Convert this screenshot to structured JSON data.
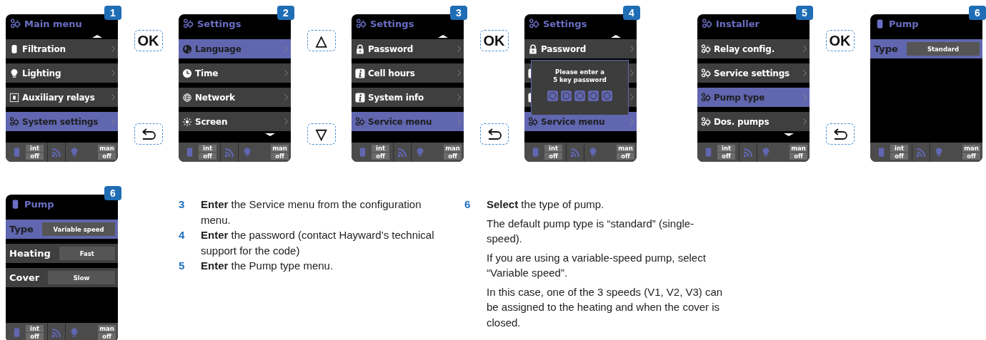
{
  "top_row": [
    {
      "kind": "screen",
      "badge": "1",
      "header": {
        "kind": "gears",
        "title": "Main menu"
      },
      "scroll_up": true,
      "scroll_down": false,
      "rows": [
        {
          "kind": "pump",
          "label": "Filtration",
          "selected": false
        },
        {
          "kind": "bulb",
          "label": "Lighting",
          "selected": false
        },
        {
          "kind": "relay",
          "label": "Auxiliary relays",
          "selected": false
        },
        {
          "kind": "gears",
          "label": "System settings",
          "selected": true
        }
      ],
      "status": {
        "filtration_mode": "int",
        "filtration_state": "off",
        "lighting_mode": "man",
        "lighting_state": "off"
      }
    },
    {
      "kind": "keys",
      "keys": [
        {
          "kind": "text",
          "label": "OK"
        },
        {
          "kind": "back"
        }
      ]
    },
    {
      "kind": "screen",
      "badge": "2",
      "header": {
        "kind": "gears",
        "title": "Settings"
      },
      "scroll_up": false,
      "scroll_down": true,
      "rows": [
        {
          "kind": "language",
          "label": "Language",
          "selected": true
        },
        {
          "kind": "clock",
          "label": "Time",
          "selected": false
        },
        {
          "kind": "network",
          "label": "Network",
          "selected": false
        },
        {
          "kind": "sun",
          "label": "Screen",
          "selected": false
        }
      ],
      "status": {
        "filtration_mode": "int",
        "filtration_state": "off",
        "lighting_mode": "man",
        "lighting_state": "off"
      }
    },
    {
      "kind": "keys",
      "keys": [
        {
          "kind": "text",
          "label": "△"
        },
        {
          "kind": "text",
          "label": "▽"
        }
      ]
    },
    {
      "kind": "screen",
      "badge": "3",
      "header": {
        "kind": "gears",
        "title": "Settings"
      },
      "scroll_up": true,
      "scroll_down": false,
      "rows": [
        {
          "kind": "lock",
          "label": "Password",
          "selected": false
        },
        {
          "kind": "info",
          "label": "Cell hours",
          "selected": false
        },
        {
          "kind": "info",
          "label": "System info",
          "selected": false
        },
        {
          "kind": "gears",
          "label": "Service menu",
          "selected": true
        }
      ],
      "status": {
        "filtration_mode": "int",
        "filtration_state": "off",
        "lighting_mode": "man",
        "lighting_state": "off"
      }
    },
    {
      "kind": "keys",
      "keys": [
        {
          "kind": "text",
          "label": "OK"
        },
        {
          "kind": "back"
        }
      ]
    },
    {
      "kind": "screen",
      "badge": "4",
      "header": {
        "kind": "gears",
        "title": "Settings"
      },
      "scroll_up": true,
      "scroll_down": false,
      "rows": [
        {
          "kind": "lock",
          "label": "Password",
          "selected": false
        },
        {
          "kind": "info",
          "selected": false
        },
        {
          "kind": "info",
          "selected": false
        },
        {
          "kind": "gears",
          "label": "Service menu",
          "selected": true
        }
      ],
      "dialog": {
        "lines": [
          "Please enter a",
          "5 key password"
        ],
        "slots": [
          {
            "entered": false
          },
          {
            "entered": false
          },
          {
            "entered": false
          },
          {
            "entered": false
          },
          {
            "entered": false
          }
        ]
      },
      "status": {
        "filtration_mode": "int",
        "filtration_state": "off",
        "lighting_mode": "man",
        "lighting_state": "off"
      }
    },
    {
      "kind": "screen",
      "badge": "5",
      "header": {
        "kind": "gears",
        "title": "Installer"
      },
      "scroll_up": false,
      "scroll_down": true,
      "rows": [
        {
          "kind": "gears",
          "label": "Relay config.",
          "selected": false
        },
        {
          "kind": "gears",
          "label": "Service settings",
          "selected": false
        },
        {
          "kind": "gears",
          "label": "Pump type",
          "selected": true
        },
        {
          "kind": "gears",
          "label": "Dos. pumps",
          "selected": false
        }
      ],
      "status": {
        "filtration_mode": "int",
        "filtration_state": "off",
        "lighting_mode": "man",
        "lighting_state": "off"
      }
    },
    {
      "kind": "keys",
      "keys": [
        {
          "kind": "text",
          "label": "OK"
        },
        {
          "kind": "back"
        }
      ]
    },
    {
      "kind": "screen",
      "badge": "6",
      "header": {
        "kind": "pump",
        "title": "Pump"
      },
      "scroll_up": false,
      "scroll_down": false,
      "rows": [
        {
          "kind": "setting",
          "label": "Type",
          "value": "Standard",
          "selected": true
        }
      ],
      "status": {
        "filtration_mode": "int",
        "filtration_state": "off",
        "lighting_mode": "man",
        "lighting_state": "off"
      }
    }
  ],
  "bottom_screen": {
    "badge": "6",
    "header": {
      "kind": "pump",
      "title": "Pump"
    },
    "scroll_up": false,
    "scroll_down": false,
    "rows": [
      {
        "kind": "setting",
        "label": "Type",
        "value": "Variable speed",
        "selected": true
      },
      {
        "kind": "setting",
        "label": "Heating",
        "value": "Fast",
        "selected": false
      },
      {
        "kind": "setting",
        "label": "Cover",
        "value": "Slow",
        "selected": false
      }
    ],
    "status": {
      "filtration_mode": "int",
      "filtration_state": "off",
      "lighting_mode": "man",
      "lighting_state": "off"
    }
  },
  "steps": [
    {
      "number": "3",
      "text": "**Enter** the Service menu from the configuration menu."
    },
    {
      "number": "4",
      "text": "**Enter** the password (contact Hayward’s technical support for the code)"
    },
    {
      "number": "5",
      "text": "**Enter** the Pump type menu."
    }
  ],
  "step_6": {
    "number": "6",
    "text": "**Select** the type of pump.",
    "paragraphs": [
      "The default pump type is “standard” (single-speed).",
      "If you are using a variable-speed pump, select “Variable speed”.",
      "In this case, one of the 3 speeds (V1, V2, V3) can be assigned to the heating and when the cover is closed."
    ]
  }
}
